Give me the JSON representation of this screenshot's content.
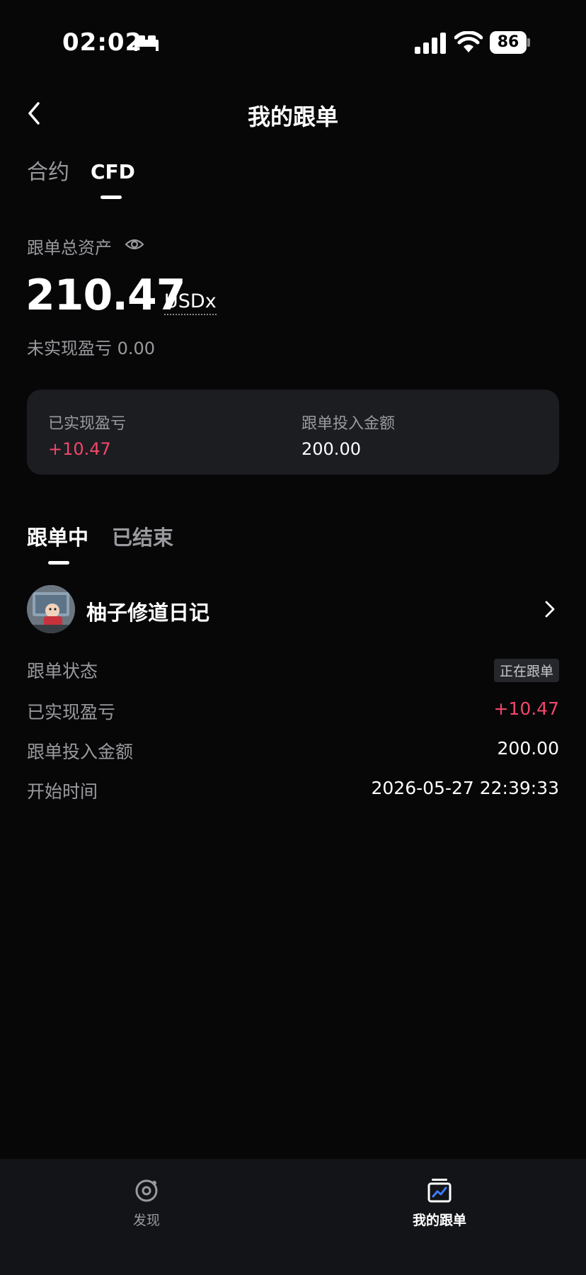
{
  "status_bar": {
    "time": "02:02",
    "battery": "86"
  },
  "header": {
    "title": "我的跟单"
  },
  "top_tabs": [
    {
      "label": "合约",
      "active": false
    },
    {
      "label": "CFD",
      "active": true
    }
  ],
  "assets": {
    "label": "跟单总资产",
    "value": "210.47",
    "unit": "USDx",
    "unrealized": "未实现盈亏 0.00"
  },
  "summary": {
    "realized_label": "已实现盈亏",
    "realized_value": "+10.47",
    "invested_label": "跟单投入金额",
    "invested_value": "200.00"
  },
  "section_tabs": [
    {
      "label": "跟单中",
      "active": true
    },
    {
      "label": "已结束",
      "active": false
    }
  ],
  "trader": {
    "name": "柚子修道日记"
  },
  "details": {
    "status_label": "跟单状态",
    "status_value": "正在跟单",
    "realized_label": "已实现盈亏",
    "realized_value": "+10.47",
    "invested_label": "跟单投入金额",
    "invested_value": "200.00",
    "start_label": "开始时间",
    "start_value": "2026-05-27 22:39:33"
  },
  "bottom_nav": [
    {
      "label": "发现",
      "icon": "discover-icon",
      "active": false
    },
    {
      "label": "我的跟单",
      "icon": "my-copy-trade-icon",
      "active": true
    }
  ],
  "colors": {
    "background": "#070708",
    "card": "#1c1d21",
    "positive": "#f2466a",
    "muted_text": "#9a9a9e",
    "nav_background": "#131417",
    "nav_active_icon": "#3d7bff"
  }
}
